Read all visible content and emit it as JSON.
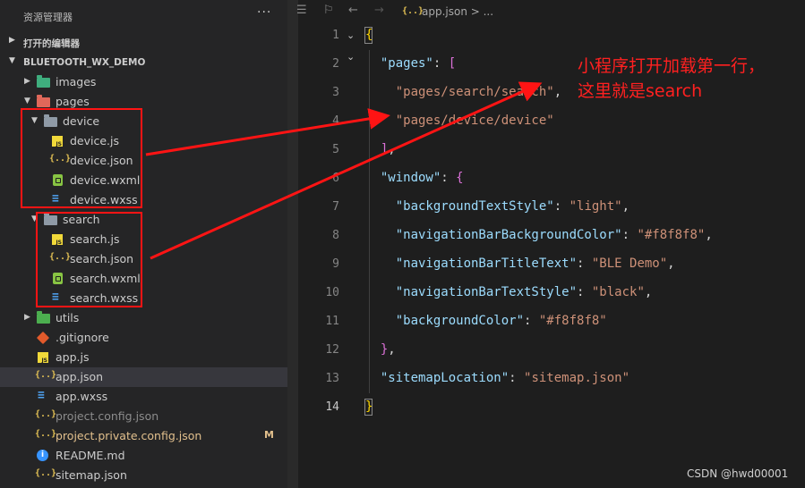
{
  "explorer": {
    "title": "资源管理器",
    "more": "···",
    "open_editors_label": "打开的编辑器",
    "project_label": "BLUETOOTH_WX_DEMO",
    "tree": [
      {
        "label": "images",
        "icon": "images-folder-icon",
        "kind": "folder",
        "expanded": false
      },
      {
        "label": "pages",
        "icon": "pages-folder-icon",
        "kind": "folder",
        "expanded": true
      },
      {
        "label": "device",
        "icon": "folder-icon",
        "kind": "folder",
        "expanded": true
      },
      {
        "label": "device.js",
        "icon": "js-file-icon",
        "kind": "file"
      },
      {
        "label": "device.json",
        "icon": "json-file-icon",
        "kind": "file"
      },
      {
        "label": "device.wxml",
        "icon": "wxml-file-icon",
        "kind": "file"
      },
      {
        "label": "device.wxss",
        "icon": "wxss-file-icon",
        "kind": "file"
      },
      {
        "label": "search",
        "icon": "folder-icon",
        "kind": "folder",
        "expanded": true
      },
      {
        "label": "search.js",
        "icon": "js-file-icon",
        "kind": "file"
      },
      {
        "label": "search.json",
        "icon": "json-file-icon",
        "kind": "file"
      },
      {
        "label": "search.wxml",
        "icon": "wxml-file-icon",
        "kind": "file"
      },
      {
        "label": "search.wxss",
        "icon": "wxss-file-icon",
        "kind": "file"
      },
      {
        "label": "utils",
        "icon": "utils-folder-icon",
        "kind": "folder",
        "expanded": false
      },
      {
        "label": ".gitignore",
        "icon": "git-icon",
        "kind": "file"
      },
      {
        "label": "app.js",
        "icon": "js-file-icon",
        "kind": "file"
      },
      {
        "label": "app.json",
        "icon": "json-file-icon",
        "kind": "file",
        "selected": true
      },
      {
        "label": "app.wxss",
        "icon": "wxss-file-icon",
        "kind": "file"
      },
      {
        "label": "project.config.json",
        "icon": "json-file-icon",
        "kind": "file",
        "dimmed": true
      },
      {
        "label": "project.private.config.json",
        "icon": "json-file-icon",
        "kind": "file",
        "modified": true,
        "badge": "M"
      },
      {
        "label": "README.md",
        "icon": "info-icon",
        "kind": "file"
      },
      {
        "label": "sitemap.json",
        "icon": "json-file-icon",
        "kind": "file"
      }
    ]
  },
  "editor": {
    "breadcrumb_icon": "{..}",
    "breadcrumb": "app.json > ...",
    "line_numbers": [
      "1",
      "2",
      "3",
      "4",
      "5",
      "6",
      "7",
      "8",
      "9",
      "10",
      "11",
      "12",
      "13",
      "14"
    ],
    "code_lines": [
      "{",
      "  \"pages\": [",
      "    \"pages/search/search\",",
      "    \"pages/device/device\"",
      "  ],",
      "  \"window\": {",
      "    \"backgroundTextStyle\": \"light\",",
      "    \"navigationBarBackgroundColor\": \"#f8f8f8\",",
      "    \"navigationBarTitleText\": \"BLE Demo\",",
      "    \"navigationBarTextStyle\": \"black\",",
      "    \"backgroundColor\": \"#f8f8f8\"",
      "  },",
      "  \"sitemapLocation\": \"sitemap.json\"",
      "}"
    ]
  },
  "annotation": {
    "line1": "小程序打开加载第一行，",
    "line2": "这里就是search",
    "color": "#ff1414"
  },
  "watermark": "CSDN @hwd00001",
  "colors": {
    "sidebar_bg": "#252526",
    "editor_bg": "#1e1e1e",
    "selection": "#37373d",
    "key": "#9cdcfe",
    "string": "#ce9178",
    "modified": "#e2c08d"
  }
}
